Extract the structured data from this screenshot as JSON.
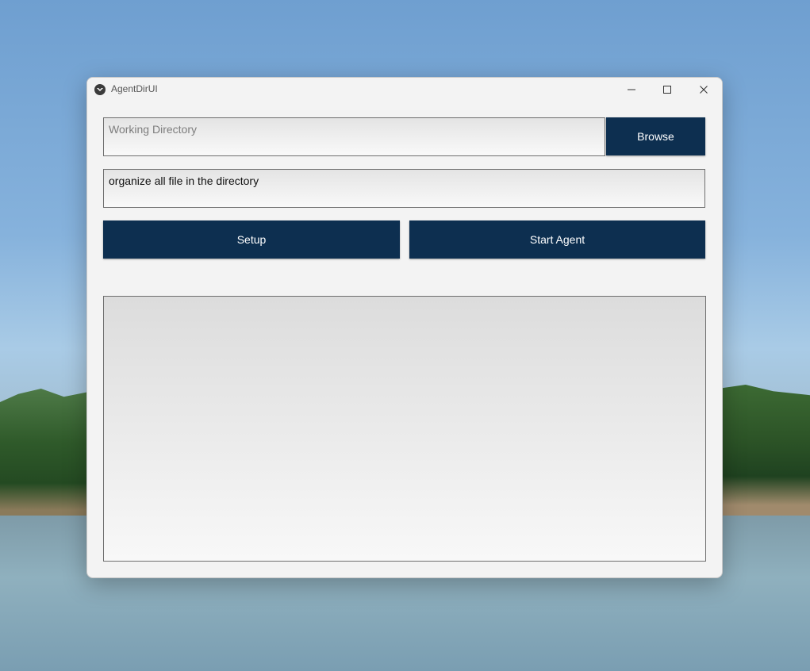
{
  "window": {
    "title": "AgentDirUI"
  },
  "working_directory": {
    "value": "",
    "placeholder": "Working Directory"
  },
  "browse_button": {
    "label": "Browse"
  },
  "task_input": {
    "value": "organize all file in the directory"
  },
  "setup_button": {
    "label": "Setup"
  },
  "start_agent_button": {
    "label": "Start Agent"
  },
  "output": {
    "text": ""
  },
  "colors": {
    "button_bg": "#0d2f50",
    "button_text": "#ffffff",
    "window_bg": "#f3f3f3"
  },
  "icons": {
    "app": "app-logo-icon",
    "minimize": "minimize-icon",
    "maximize": "maximize-icon",
    "close": "close-icon"
  }
}
